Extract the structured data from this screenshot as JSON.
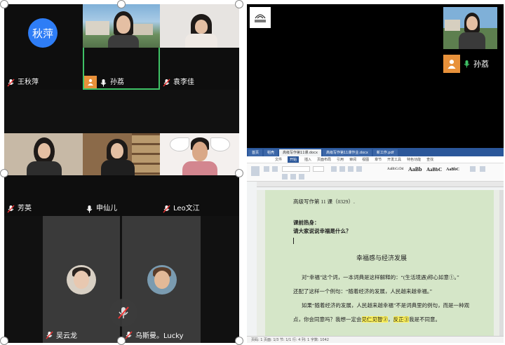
{
  "participants": {
    "wang": {
      "avatar_text": "秋萍",
      "name": "王秋萍"
    },
    "sun": {
      "name": "孙荔"
    },
    "yuan": {
      "name": "袁李佳"
    },
    "fang": {
      "name": "芳英"
    },
    "shen": {
      "name": "申仙儿"
    },
    "leo": {
      "name": "Leo文江"
    },
    "wu": {
      "name": "吴云龙"
    },
    "wusi": {
      "name": "乌斯曼。Lucky"
    }
  },
  "shared": {
    "presenter_name": "孙荔",
    "tabs": [
      "首页",
      "稻壳",
      "高级写作第11课.docx",
      "高级写作第11课作业.docx",
      "新工作.pdf"
    ],
    "menus": [
      "文件",
      "开始",
      "插入",
      "页面布局",
      "引用",
      "审阅",
      "视图",
      "章节",
      "开发工具",
      "特色功能",
      "查找"
    ],
    "style_samples": [
      "AaBbCcDd",
      "AaBb",
      "AaBbC",
      "AaBbC"
    ],
    "doc": {
      "header": "高级写作第 11 课（0329）.",
      "warmup": "课前热身：",
      "question": "请大家说说幸福是什么？",
      "title": "幸福感与经济发展",
      "p1a": "对“幸福”这个词，一本词典是这样解释的：“(生活境遇)称心如意①。”",
      "p1b": "还配了这样一个例句：“随着经济的发展，人民越来越幸福。”",
      "p2a": "如果“随着经济的发展，人民越来越幸福”不是词典里的例句，而是一种观",
      "p2b_pre": "点，你会同意吗？我想一定会",
      "p2b_hl1": "见仁见智②",
      "p2b_mid": "，",
      "p2b_hl2": "反正③",
      "p2b_post": "我是不同意。"
    },
    "status": "页码: 1  页面: 1/3  节: 1/1  行: 4  列: 1  字数: 1042"
  },
  "colors": {
    "speaker_border": "#3fc266",
    "avatar_blue": "#2e7df6",
    "person_tag": "#e8913a",
    "doc_page": "#d5e6c8",
    "highlight": "#fff35a"
  }
}
